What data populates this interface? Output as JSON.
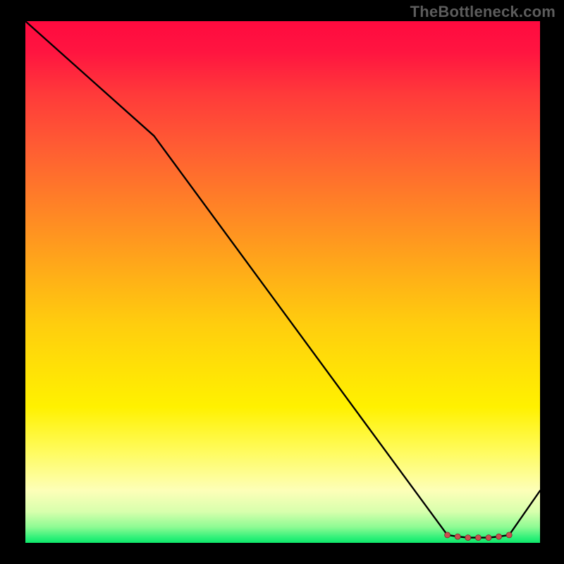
{
  "watermark": "TheBottleneck.com",
  "chart_data": {
    "type": "line",
    "title": "",
    "xlabel": "",
    "ylabel": "",
    "xlim": [
      0,
      100
    ],
    "ylim": [
      0,
      100
    ],
    "series": [
      {
        "name": "curve",
        "x": [
          0,
          25,
          82,
          84,
          86,
          88,
          90,
          92,
          94,
          100
        ],
        "values": [
          100,
          78,
          1.5,
          1.2,
          1.0,
          1.0,
          1.0,
          1.2,
          1.5,
          10
        ]
      }
    ],
    "markers": {
      "x": [
        82,
        84,
        86,
        88,
        90,
        92,
        94
      ],
      "values": [
        1.5,
        1.2,
        1.0,
        1.0,
        1.0,
        1.2,
        1.5
      ],
      "color": "#c94f4f",
      "radius": 4
    },
    "gradient_stops": [
      {
        "pct": 0,
        "color": "#ff0a3f"
      },
      {
        "pct": 50,
        "color": "#ffb316"
      },
      {
        "pct": 80,
        "color": "#fffb58"
      },
      {
        "pct": 100,
        "color": "#0ee76a"
      }
    ]
  }
}
